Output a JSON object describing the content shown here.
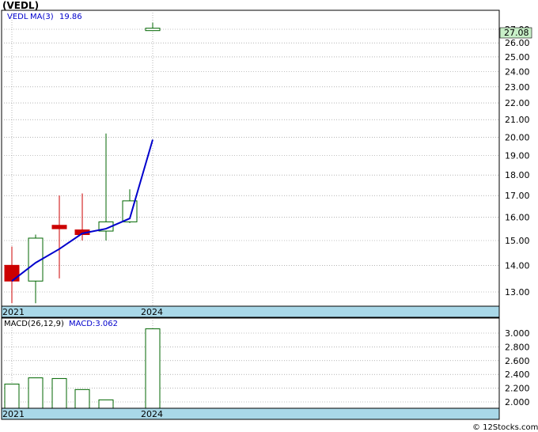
{
  "ticker": "(VEDL)",
  "legend": {
    "symbol": "VEDL",
    "ma_label": "MA(3)",
    "ma_value": "19.86"
  },
  "last_price_tag": "27.08",
  "macd_legend": {
    "params": "MACD(26,12,9)",
    "value_label": "MACD:3.062"
  },
  "watermark": "© 12Stocks.com",
  "colors": {
    "up": "#006600",
    "down": "#cc0000",
    "ma": "#0000cc",
    "band": "#a9d8e8",
    "tag": "#c8f0c8"
  },
  "chart_data": [
    {
      "type": "candlestick",
      "title": "(VEDL)",
      "x_labels": [
        "2021",
        "",
        "",
        "",
        "",
        "",
        "2024"
      ],
      "year_marks": [
        "2021",
        "2024"
      ],
      "y_scale": "log",
      "yticks": [
        "13.00",
        "14.00",
        "15.00",
        "16.00",
        "17.00",
        "18.00",
        "19.00",
        "20.00",
        "21.00",
        "22.00",
        "23.00",
        "24.00",
        "25.00",
        "26.00",
        "27.00"
      ],
      "ylim": [
        12.4,
        28.6
      ],
      "series": [
        {
          "name": "VEDL",
          "candles": [
            {
              "o": 14.0,
              "h": 14.75,
              "l": 12.6,
              "c": 13.4,
              "dir": "down"
            },
            {
              "o": 13.4,
              "h": 15.25,
              "l": 12.6,
              "c": 15.1,
              "dir": "up"
            },
            {
              "o": 15.65,
              "h": 17.0,
              "l": 13.5,
              "c": 15.5,
              "dir": "down"
            },
            {
              "o": 15.45,
              "h": 17.1,
              "l": 15.0,
              "c": 15.25,
              "dir": "down"
            },
            {
              "o": 15.4,
              "h": 20.2,
              "l": 15.0,
              "c": 15.8,
              "dir": "up"
            },
            {
              "o": 15.8,
              "h": 17.3,
              "l": 15.75,
              "c": 16.75,
              "dir": "up"
            },
            {
              "o": 26.9,
              "h": 27.5,
              "l": 26.9,
              "c": 27.08,
              "dir": "up"
            }
          ]
        },
        {
          "name": "MA(3)",
          "values": [
            13.4,
            14.1,
            14.65,
            15.3,
            15.5,
            15.95,
            19.86
          ]
        }
      ]
    },
    {
      "type": "bar",
      "title": "MACD(26,12,9)",
      "x_labels": [
        "2021",
        "",
        "",
        "",
        "",
        "",
        "2024"
      ],
      "year_marks": [
        "2021",
        "2024"
      ],
      "yticks": [
        "2.000",
        "2.200",
        "2.400",
        "2.600",
        "2.800",
        "3.000"
      ],
      "ylim": [
        1.92,
        3.12
      ],
      "values": [
        2.26,
        2.35,
        2.34,
        2.18,
        2.03,
        1.8,
        3.062
      ]
    }
  ]
}
